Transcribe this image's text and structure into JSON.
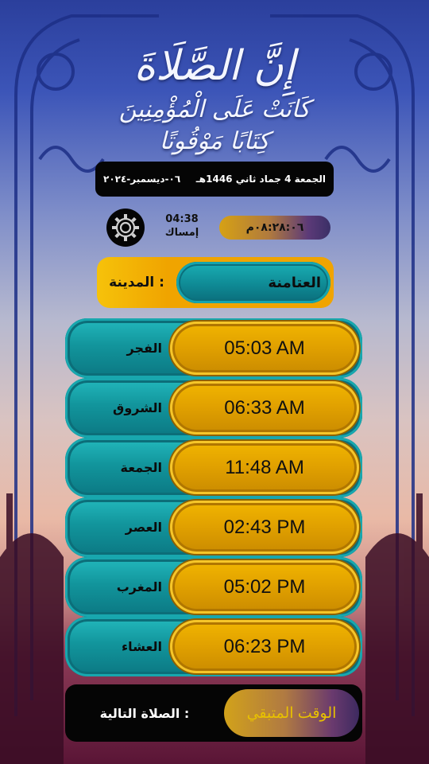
{
  "header": {
    "calligraphy_line1": "إِنَّ الصَّلَاةَ",
    "calligraphy_line2": "كَانَتْ عَلَى الْمُؤْمِنِينَ كِتَابًا مَوْقُوتًا"
  },
  "date_bar": {
    "hijri": "الجمعة 4 جماد ثاني 1446هـ",
    "gregorian": "٠٦-ديسمبر-٢٠٢٤"
  },
  "imsak": {
    "time": "04:38",
    "label": "إمساك"
  },
  "countdown": {
    "value": "٠٨:٢٨:٠٦م"
  },
  "icons": {
    "settings": "gear-icon"
  },
  "city": {
    "label": "المدينة :",
    "value": "العتامنة"
  },
  "prayers": [
    {
      "name": "الفجر",
      "time": "05:03 AM"
    },
    {
      "name": "الشروق",
      "time": "06:33 AM"
    },
    {
      "name": "الجمعة",
      "time": "11:48 AM"
    },
    {
      "name": "العصر",
      "time": "02:43 PM"
    },
    {
      "name": "المغرب",
      "time": "05:02 PM"
    },
    {
      "name": "العشاء",
      "time": "06:23 PM"
    }
  ],
  "next_prayer": {
    "label": "الصلاة التالية :",
    "value": "الوقت المتبقي"
  },
  "colors": {
    "teal": "#12959c",
    "gold": "#e0a000",
    "black": "#050505"
  }
}
